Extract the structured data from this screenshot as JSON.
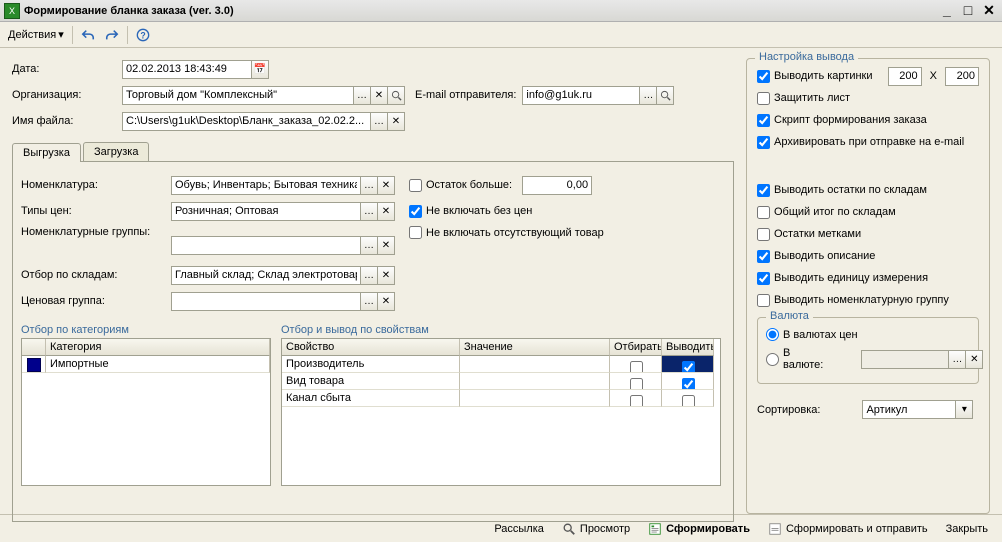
{
  "window": {
    "title": "Формирование бланка заказа (ver. 3.0)"
  },
  "toolbar": {
    "actions_label": "Действия"
  },
  "fields": {
    "date_label": "Дата:",
    "date_value": "02.02.2013 18:43:49",
    "org_label": "Организация:",
    "org_value": "Торговый дом \"Комплексный\"",
    "email_label": "E-mail отправителя:",
    "email_value": "info@g1uk.ru",
    "filename_label": "Имя файла:",
    "filename_value": "C:\\Users\\g1uk\\Desktop\\Бланк_заказа_02.02.2..."
  },
  "tabs": {
    "t1": "Выгрузка",
    "t2": "Загрузка"
  },
  "filters": {
    "nomen_label": "Номенклатура:",
    "nomen_value": "Обувь; Инвентарь; Бытовая техника; М...",
    "pricetypes_label": "Типы цен:",
    "pricetypes_value": "Розничная; Оптовая",
    "nomengroups_label": "Номенклатурные группы:",
    "nomengroups_value": "",
    "bywarehouse_label": "Отбор по складам:",
    "bywarehouse_value": "Главный склад; Склад электротоваров ...",
    "pricegroup_label": "Ценовая группа:",
    "pricegroup_value": "",
    "balance_label": "Остаток больше:",
    "balance_value": "0,00",
    "nopriceskip_label": "Не включать без цен",
    "nomissing_label": "Не включать отсутствующий товар"
  },
  "catsection": {
    "title": "Отбор по категориям",
    "col1": "",
    "col2": "Категория",
    "rows": [
      "Импортные"
    ]
  },
  "propsection": {
    "title": "Отбор и вывод по свойствам",
    "col1": "Свойство",
    "col2": "Значение",
    "col3": "Отбирать",
    "col4": "Выводить",
    "rows": [
      {
        "prop": "Производитель",
        "val": "",
        "select": false,
        "out": true,
        "active": true
      },
      {
        "prop": "Вид товара",
        "val": "",
        "select": false,
        "out": true,
        "active": false
      },
      {
        "prop": "Канал сбыта",
        "val": "",
        "select": false,
        "out": false,
        "active": false
      }
    ]
  },
  "output": {
    "legend": "Настройка вывода",
    "showpics": "Выводить картинки",
    "pic_w": "200",
    "pic_x": "X",
    "pic_h": "200",
    "protect": "Защитить лист",
    "script": "Скрипт формирования заказа",
    "archive": "Архивировать при отправке на e-mail",
    "stock_by_wh": "Выводить остатки по складам",
    "total_by_wh": "Общий итог по складам",
    "stock_marks": "Остатки метками",
    "show_desc": "Выводить описание",
    "show_unit": "Выводить единицу измерения",
    "show_nomengroup": "Выводить номенклатурную группу",
    "currency_legend": "Валюта",
    "curr_prices": "В валютах цен",
    "curr_in": "В валюте:",
    "sort_label": "Сортировка:",
    "sort_value": "Артикул"
  },
  "status": {
    "mailing": "Рассылка",
    "preview": "Просмотр",
    "form": "Сформировать",
    "formsend": "Сформировать и отправить",
    "close": "Закрыть"
  }
}
